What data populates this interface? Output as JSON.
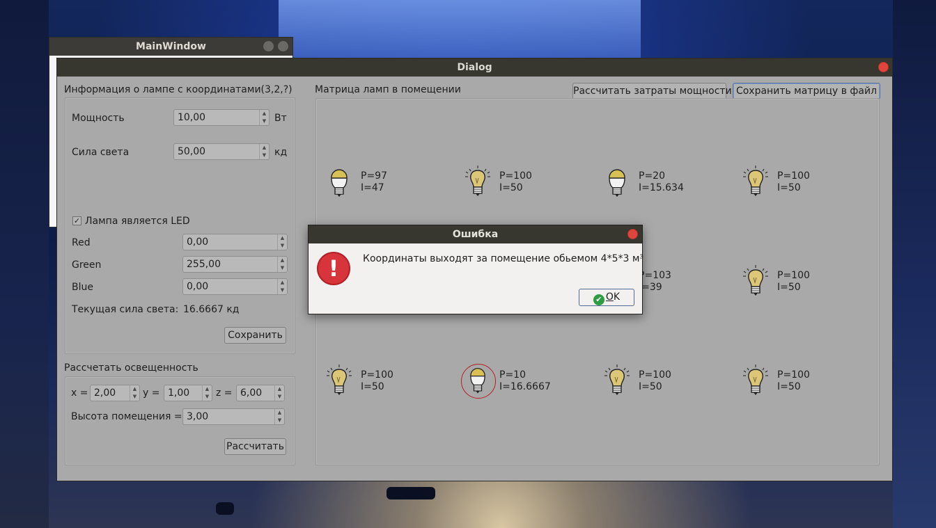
{
  "main_window": {
    "title": "MainWindow"
  },
  "dialog": {
    "title": "Dialog",
    "lamp_info": {
      "title": "Информация о лампе с координатами(3,2,?)",
      "power_label": "Мощность",
      "power_value": "10,00",
      "power_unit": "Вт",
      "intensity_label": "Сила света",
      "intensity_value": "50,00",
      "intensity_unit": "кд",
      "led_checkbox_label": "Лампа является LED",
      "led_checked": true,
      "red_label": "Red",
      "red_value": "0,00",
      "green_label": "Green",
      "green_value": "255,00",
      "blue_label": "Blue",
      "blue_value": "0,00",
      "current_intensity_label": "Текущая сила света:",
      "current_intensity_value": "16.6667 кд",
      "save_button": "Сохранить"
    },
    "illumination": {
      "title": "Рассчетать освещенность",
      "x_label": "x =",
      "x_value": "2,00",
      "y_label": "y =",
      "y_value": "1,00",
      "z_label": "z =",
      "z_value": "6,00",
      "height_label": "Высота помещения =",
      "height_value": "3,00",
      "calc_button": "Рассчитать"
    },
    "matrix": {
      "title": "Матрица ламп в помещении",
      "calc_power_button": "Рассчитать затраты мощности",
      "save_file_button": "Сохранить матрицу в файл",
      "lamps": [
        {
          "p": "P=97",
          "i": "I=47",
          "kind": "led"
        },
        {
          "p": "P=100",
          "i": "I=50",
          "kind": "bulb"
        },
        {
          "p": "P=20",
          "i": "I=15.634",
          "kind": "led"
        },
        {
          "p": "P=100",
          "i": "I=50",
          "kind": "bulb"
        },
        {
          "p": "P=103",
          "i": "I=39",
          "kind": "hidden"
        },
        {
          "p": "P=100",
          "i": "I=50",
          "kind": "bulb"
        },
        {
          "p": "P=100",
          "i": "I=50",
          "kind": "bulb"
        },
        {
          "p": "P=10",
          "i": "I=16.6667",
          "kind": "led-selected"
        },
        {
          "p": "P=100",
          "i": "I=50",
          "kind": "bulb"
        },
        {
          "p": "P=100",
          "i": "I=50",
          "kind": "bulb"
        }
      ]
    }
  },
  "error_dialog": {
    "title": "Ошибка",
    "message": "Координаты выходят за помещение обьемом 4*5*3 м³",
    "icon": "error-exclamation-icon",
    "ok_mnemonic": "O",
    "ok_rest": "K"
  }
}
